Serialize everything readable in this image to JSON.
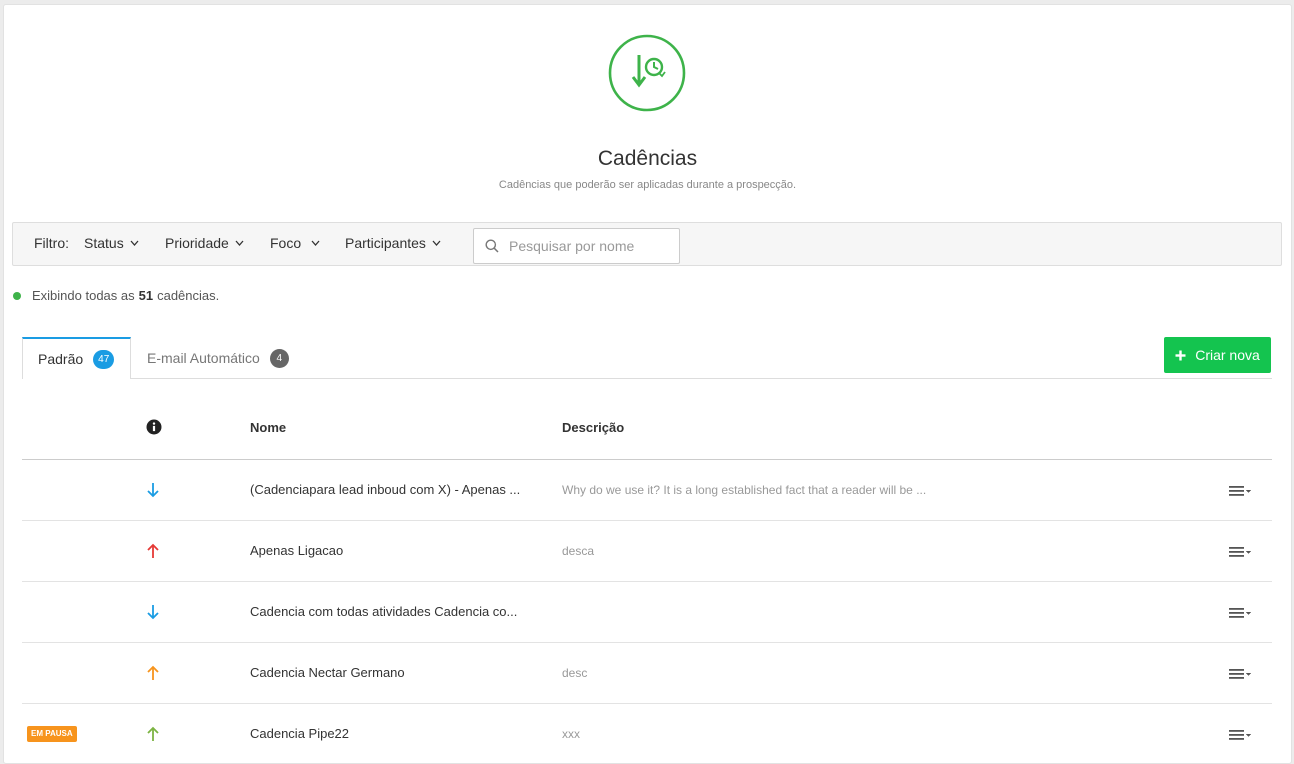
{
  "header": {
    "icon": "cadence-download-clock-icon",
    "title": "Cadências",
    "subtitle": "Cadências que poderão ser aplicadas durante a prospecção."
  },
  "filters": {
    "label": "Filtro:",
    "dropdowns": [
      "Status",
      "Prioridade",
      "Foco",
      "Participantes"
    ],
    "search_placeholder": "Pesquisar por nome",
    "search_value": ""
  },
  "status": {
    "prefix": "Exibindo todas as",
    "count": "51",
    "suffix": "cadências.",
    "dot_color": "#3eb34a"
  },
  "tabs": [
    {
      "label": "Padrão",
      "badge": "47",
      "active": true
    },
    {
      "label": "E-mail Automático",
      "badge": "4",
      "active": false
    }
  ],
  "actions": {
    "create_label": "Criar nova"
  },
  "table": {
    "columns": [
      "Nome",
      "Descrição"
    ],
    "rows": [
      {
        "badge": "",
        "priority": "down",
        "color": "#1a9ce3",
        "name": "(Cadenciapara lead inboud com X) - Apenas ...",
        "description": "Why do we use it? It is a long established fact that a reader will be ..."
      },
      {
        "badge": "",
        "priority": "up",
        "color": "#e53935",
        "name": "Apenas Ligacao",
        "description": "desca"
      },
      {
        "badge": "",
        "priority": "down",
        "color": "#1a9ce3",
        "name": "Cadencia com todas atividades Cadencia co...",
        "description": ""
      },
      {
        "badge": "",
        "priority": "up",
        "color": "#f7941d",
        "name": "Cadencia Nectar Germano",
        "description": "desc"
      },
      {
        "badge": "EM PAUSA",
        "priority": "up",
        "color": "#7cb342",
        "name": "Cadencia Pipe22",
        "description": "xxx"
      }
    ]
  },
  "colors": {
    "accent_green": "#14c44f",
    "tab_blue": "#1a9ce3",
    "icon_green": "#3eb34a",
    "pause_orange": "#f7941d"
  }
}
